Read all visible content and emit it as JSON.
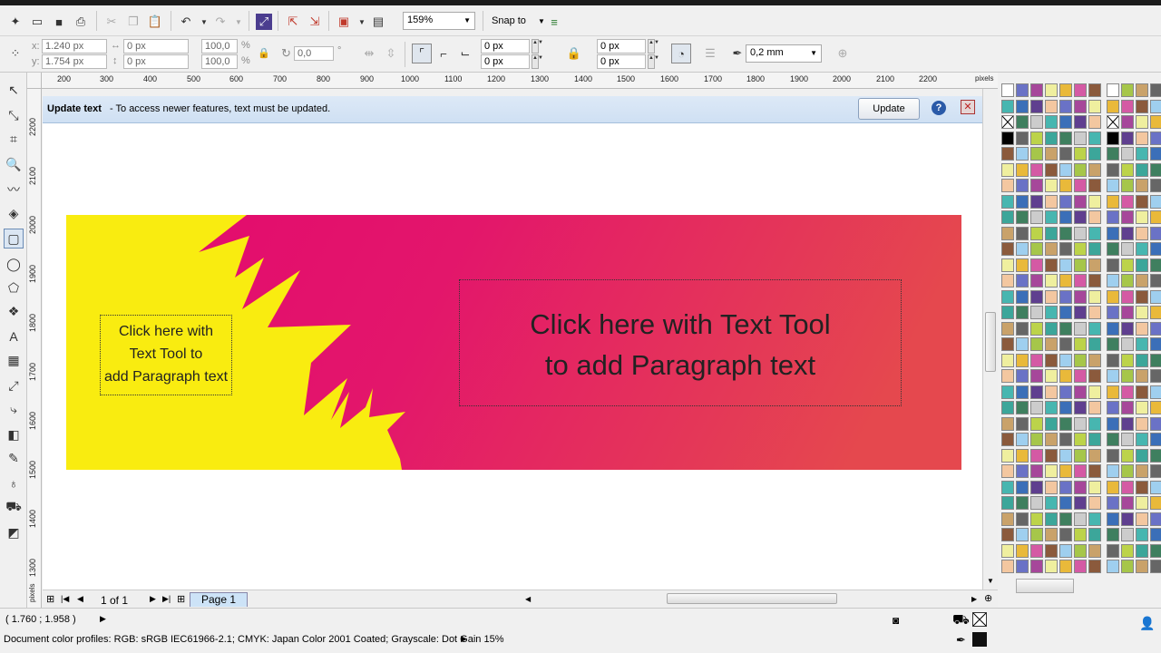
{
  "toolbar": {
    "zoom": "159%",
    "snap_label": "Snap to"
  },
  "propbar": {
    "x_label": "x:",
    "x_value": "1.240 px",
    "y_label": "y:",
    "y_value": "1.754 px",
    "w_value": "0 px",
    "h_value": "0 px",
    "sx_value": "100,0",
    "sy_value": "100,0",
    "pct": "%",
    "angle_value": "0,0",
    "deg": "°",
    "c1": "0 px",
    "c2": "0 px",
    "c3": "0 px",
    "c4": "0 px",
    "outline_value": "0,2 mm"
  },
  "rulers": {
    "unit": "pixels",
    "h_ticks": [
      "200",
      "300",
      "400",
      "500",
      "600",
      "700",
      "800",
      "900",
      "1000",
      "1100",
      "1200",
      "1300",
      "1400",
      "1500",
      "1600",
      "1700",
      "1800",
      "1900",
      "2000",
      "2100",
      "2200"
    ],
    "v_ticks": [
      "2200",
      "2100",
      "2000",
      "1900",
      "1800",
      "1700",
      "1600",
      "1500",
      "1400",
      "1300"
    ]
  },
  "infobar": {
    "title": "Update text",
    "message": "- To access newer features, text must be updated.",
    "button": "Update"
  },
  "banner": {
    "left_text": [
      "Click here with",
      "Text Tool to",
      "add Paragraph text"
    ],
    "right_text": [
      "Click here with Text Tool",
      "to add Paragraph text"
    ],
    "colors": {
      "yellow": "#f9ec10",
      "magenta": "#e3096f",
      "coral": "#e5484e"
    }
  },
  "pagenav": {
    "count": "1 of 1",
    "tab": "Page 1"
  },
  "status": {
    "coords": "( 1.760 ; 1.958  )",
    "profiles": "Document color profiles: RGB: sRGB IEC61966-2.1; CMYK: Japan Color 2001 Coated; Grayscale: Dot Gain 15%"
  }
}
